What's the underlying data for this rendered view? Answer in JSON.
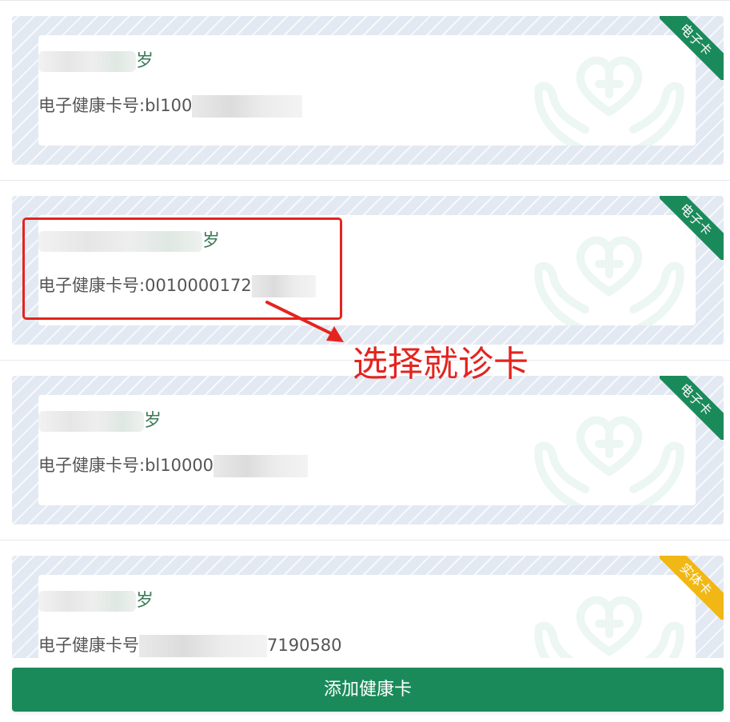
{
  "cards": [
    {
      "age_unit": "岁",
      "number_label": "电子健康卡号:",
      "number_visible": "bl100",
      "badge": "电子卡"
    },
    {
      "age_unit": "岁",
      "number_label": "电子健康卡号:",
      "number_visible": "0010000172",
      "badge": "电子卡"
    },
    {
      "age_unit": "岁",
      "number_label": "电子健康卡号:",
      "number_visible": "bl10000",
      "badge": "电子卡"
    },
    {
      "age_unit": "岁",
      "number_label": "电子健康卡号",
      "number_visible_suffix": "7190580",
      "badge": "实体卡"
    }
  ],
  "annotation": {
    "text": "选择就诊卡"
  },
  "bottom": {
    "add_label": "添加健康卡"
  },
  "colors": {
    "primary": "#1b8a5a",
    "annotation_red": "#e3241f",
    "physical_badge": "#f1b815",
    "card_background": "#e3e9f2"
  },
  "icons": {
    "watermark": "heart-hands-icon"
  }
}
